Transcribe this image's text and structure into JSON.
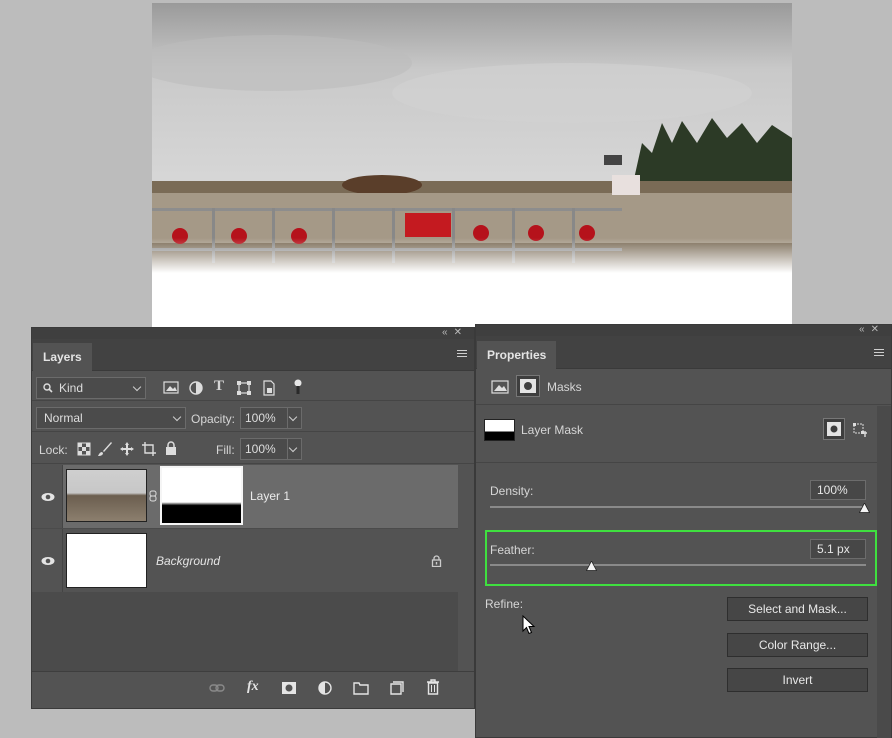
{
  "layers_panel": {
    "tab_label": "Layers",
    "filter": {
      "value": "Kind"
    },
    "blend_mode": {
      "value": "Normal"
    },
    "opacity": {
      "label": "Opacity:",
      "value": "100%"
    },
    "lock": {
      "label": "Lock:"
    },
    "fill": {
      "label": "Fill:",
      "value": "100%"
    },
    "layers": [
      {
        "name": "Layer 1",
        "visible": true,
        "has_mask": true
      },
      {
        "name": "Background",
        "visible": true,
        "locked": true
      }
    ],
    "footer_icons": [
      "link-icon",
      "fx-icon",
      "add-mask-icon",
      "adjustment-icon",
      "folder-icon",
      "new-layer-icon",
      "trash-icon"
    ]
  },
  "properties_panel": {
    "tab_label": "Properties",
    "section": "Masks",
    "mask_type": "Layer Mask",
    "density": {
      "label": "Density:",
      "value": "100%",
      "level": 1.0
    },
    "feather": {
      "label": "Feather:",
      "value": "5.1 px",
      "level": 0.27
    },
    "refine": {
      "label": "Refine:"
    },
    "buttons": {
      "select_and_mask": "Select and Mask...",
      "color_range": "Color Range...",
      "invert": "Invert"
    },
    "highlight_color": "#3fe03f"
  }
}
